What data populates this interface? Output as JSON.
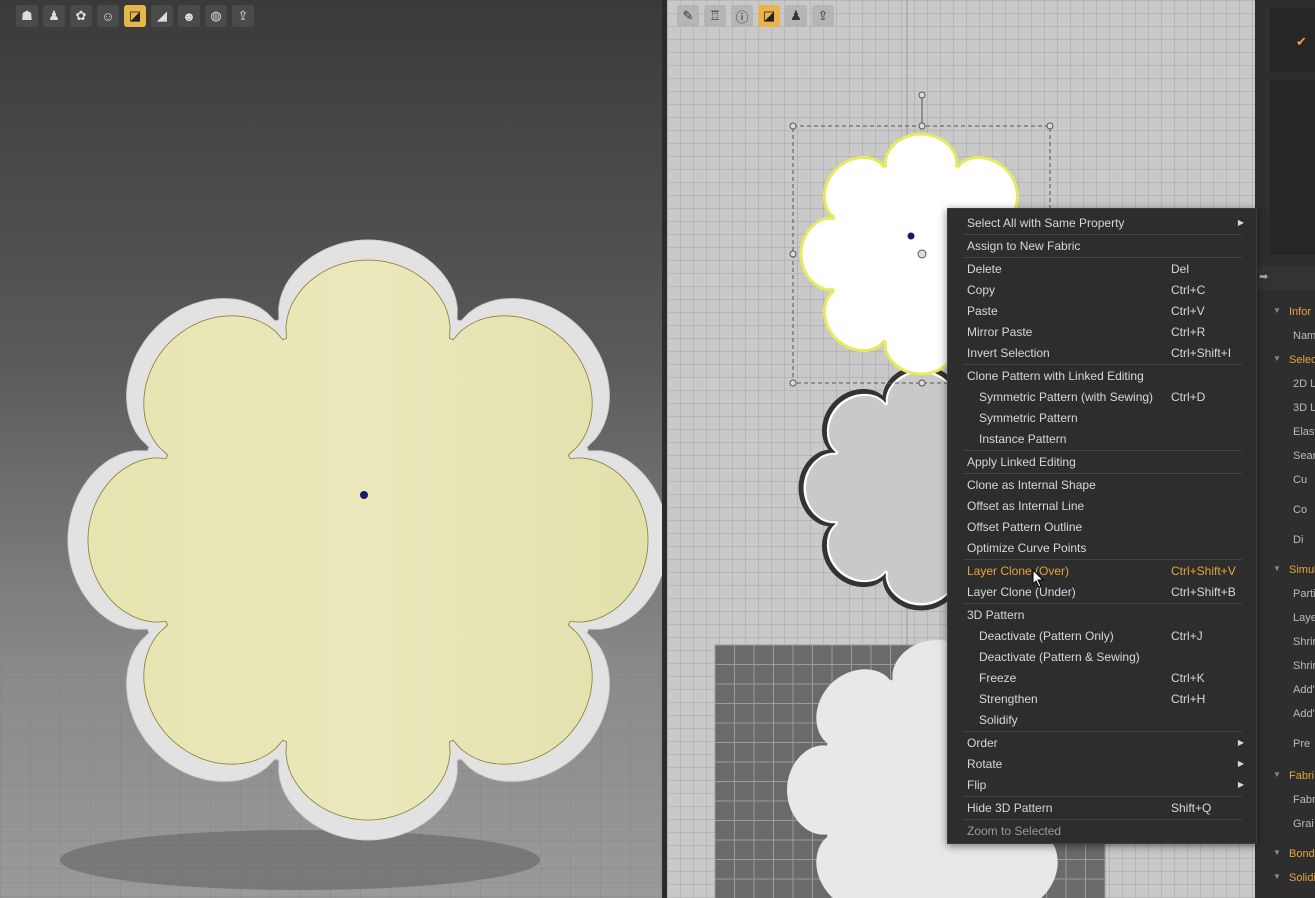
{
  "left_toolbar": {
    "icons": [
      "avatar-icon",
      "garment-icon",
      "fabric-icon",
      "person-icon",
      "pattern-icon",
      "texture-icon",
      "profile-icon",
      "globe-icon",
      "export-icon"
    ],
    "active_index": 4
  },
  "right_toolbar": {
    "icons": [
      "pen-icon",
      "shirt-icon",
      "info-icon",
      "pattern-icon",
      "garment-icon",
      "export-icon"
    ],
    "active_index": 3
  },
  "context_menu": {
    "items": [
      {
        "label": "Select All with Same Property",
        "shortcut": "",
        "submenu": true,
        "sub": false,
        "state": "normal"
      },
      {
        "label": "Assign to New Fabric",
        "shortcut": "",
        "submenu": false,
        "sub": false,
        "state": "normal"
      },
      {
        "label": "Delete",
        "shortcut": "Del",
        "submenu": false,
        "sub": false,
        "state": "normal"
      },
      {
        "label": "Copy",
        "shortcut": "Ctrl+C",
        "submenu": false,
        "sub": false,
        "state": "normal"
      },
      {
        "label": "Paste",
        "shortcut": "Ctrl+V",
        "submenu": false,
        "sub": false,
        "state": "normal"
      },
      {
        "label": "Mirror Paste",
        "shortcut": "Ctrl+R",
        "submenu": false,
        "sub": false,
        "state": "normal"
      },
      {
        "label": "Invert Selection",
        "shortcut": "Ctrl+Shift+I",
        "submenu": false,
        "sub": false,
        "state": "normal"
      },
      {
        "label": "Clone Pattern with Linked Editing",
        "shortcut": "",
        "submenu": false,
        "sub": false,
        "state": "normal"
      },
      {
        "label": "Symmetric Pattern (with Sewing)",
        "shortcut": "Ctrl+D",
        "submenu": false,
        "sub": true,
        "state": "normal"
      },
      {
        "label": "Symmetric Pattern",
        "shortcut": "",
        "submenu": false,
        "sub": true,
        "state": "normal"
      },
      {
        "label": "Instance Pattern",
        "shortcut": "",
        "submenu": false,
        "sub": true,
        "state": "normal"
      },
      {
        "label": "Apply Linked Editing",
        "shortcut": "",
        "submenu": false,
        "sub": false,
        "state": "normal"
      },
      {
        "label": "Clone as Internal Shape",
        "shortcut": "",
        "submenu": false,
        "sub": false,
        "state": "normal"
      },
      {
        "label": "Offset as Internal Line",
        "shortcut": "",
        "submenu": false,
        "sub": false,
        "state": "normal"
      },
      {
        "label": "Offset Pattern Outline",
        "shortcut": "",
        "submenu": false,
        "sub": false,
        "state": "normal"
      },
      {
        "label": "Optimize Curve Points",
        "shortcut": "",
        "submenu": false,
        "sub": false,
        "state": "normal"
      },
      {
        "label": "Layer Clone (Over)",
        "shortcut": "Ctrl+Shift+V",
        "submenu": false,
        "sub": false,
        "state": "highlight"
      },
      {
        "label": "Layer Clone (Under)",
        "shortcut": "Ctrl+Shift+B",
        "submenu": false,
        "sub": false,
        "state": "normal"
      },
      {
        "label": "3D Pattern",
        "shortcut": "",
        "submenu": false,
        "sub": false,
        "state": "normal"
      },
      {
        "label": "Deactivate (Pattern Only)",
        "shortcut": "Ctrl+J",
        "submenu": false,
        "sub": true,
        "state": "normal"
      },
      {
        "label": "Deactivate (Pattern & Sewing)",
        "shortcut": "",
        "submenu": false,
        "sub": true,
        "state": "normal"
      },
      {
        "label": "Freeze",
        "shortcut": "Ctrl+K",
        "submenu": false,
        "sub": true,
        "state": "normal"
      },
      {
        "label": "Strengthen",
        "shortcut": "Ctrl+H",
        "submenu": false,
        "sub": true,
        "state": "normal"
      },
      {
        "label": "Solidify",
        "shortcut": "",
        "submenu": false,
        "sub": true,
        "state": "normal"
      },
      {
        "label": "Order",
        "shortcut": "",
        "submenu": true,
        "sub": false,
        "state": "normal"
      },
      {
        "label": "Rotate",
        "shortcut": "",
        "submenu": true,
        "sub": false,
        "state": "normal"
      },
      {
        "label": "Flip",
        "shortcut": "",
        "submenu": true,
        "sub": false,
        "state": "normal"
      },
      {
        "label": "Hide 3D Pattern",
        "shortcut": "Shift+Q",
        "submenu": false,
        "sub": false,
        "state": "normal"
      },
      {
        "label": "Zoom to Selected",
        "shortcut": "",
        "submenu": false,
        "sub": false,
        "state": "dim"
      }
    ]
  },
  "property_panel": {
    "rows": [
      {
        "text": "Infor",
        "kind": "head"
      },
      {
        "text": "Nam",
        "kind": "field"
      },
      {
        "text": "Selec",
        "kind": "head"
      },
      {
        "text": "2D L",
        "kind": "field"
      },
      {
        "text": "3D L",
        "kind": "field"
      },
      {
        "text": "Elast",
        "kind": "field"
      },
      {
        "text": "Sear",
        "kind": "field"
      },
      {
        "text": "Cu",
        "kind": "field"
      },
      {
        "text": "Co",
        "kind": "field"
      },
      {
        "text": "Di",
        "kind": "field"
      },
      {
        "text": "Simul",
        "kind": "head"
      },
      {
        "text": "Parti",
        "kind": "field"
      },
      {
        "text": "Laye",
        "kind": "field"
      },
      {
        "text": "Shrir",
        "kind": "field"
      },
      {
        "text": "Shrir",
        "kind": "field"
      },
      {
        "text": "Add'",
        "kind": "field"
      },
      {
        "text": "Add'",
        "kind": "field"
      },
      {
        "text": "Pre",
        "kind": "field"
      },
      {
        "text": "Fabri",
        "kind": "head"
      },
      {
        "text": "Fabri",
        "kind": "field"
      },
      {
        "text": "Grai",
        "kind": "field"
      },
      {
        "text": "Bond",
        "kind": "head"
      },
      {
        "text": "Solidif",
        "kind": "head"
      }
    ]
  },
  "colors": {
    "accent": "#e8a33a",
    "fabric": "#e9e7b6",
    "fabric_edge": "#e2e2e2"
  }
}
